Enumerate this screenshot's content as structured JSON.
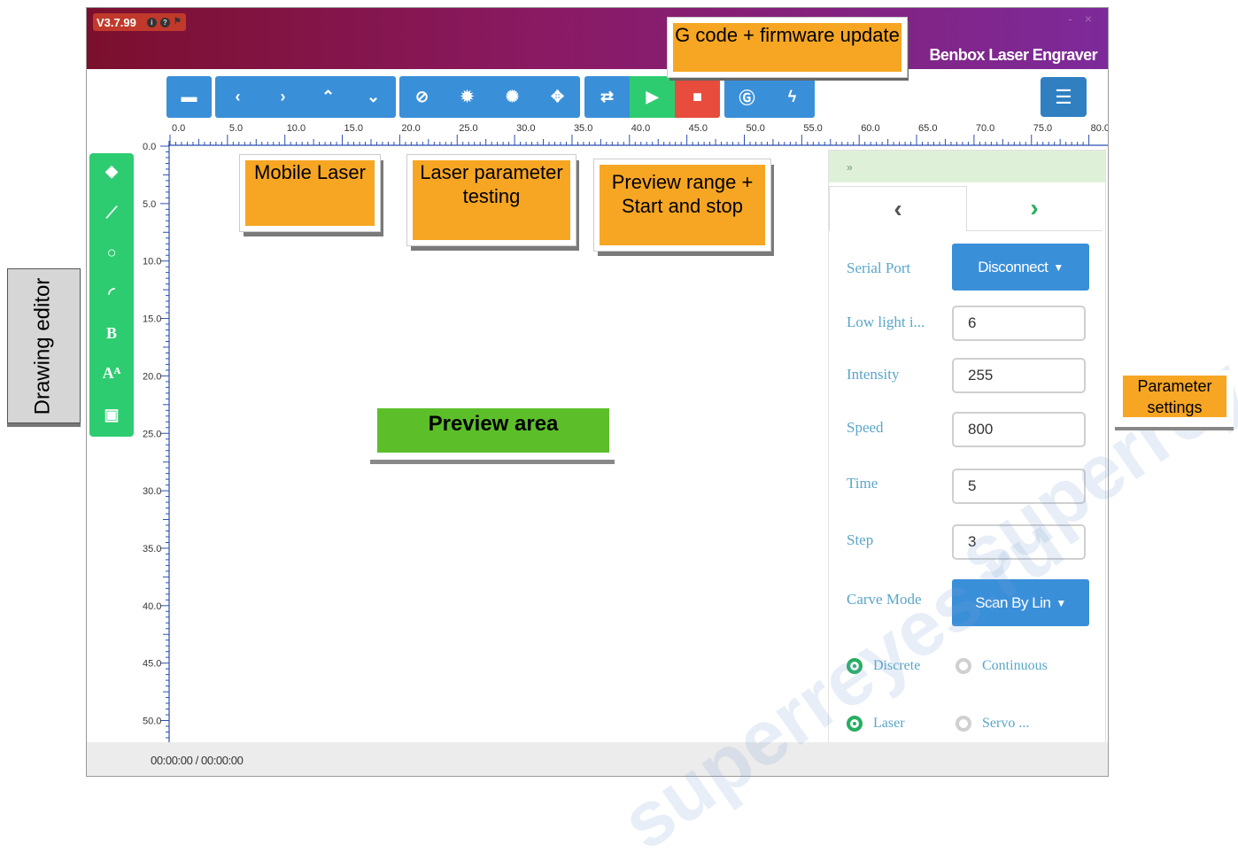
{
  "window": {
    "version": "V3.7.99",
    "title": "Benbox Laser Engraver",
    "minimize": "-",
    "close": "×"
  },
  "toolbar": {
    "groups": [
      {
        "name": "file",
        "buttons": [
          {
            "icon": "folder-open-icon",
            "glyph": "▬"
          }
        ]
      },
      {
        "name": "move",
        "buttons": [
          {
            "icon": "chevron-left-icon",
            "glyph": "‹"
          },
          {
            "icon": "chevron-right-icon",
            "glyph": "›"
          },
          {
            "icon": "chevron-up-icon",
            "glyph": "⌃"
          },
          {
            "icon": "chevron-down-icon",
            "glyph": "⌄"
          }
        ]
      },
      {
        "name": "laser-test",
        "buttons": [
          {
            "icon": "ban-icon",
            "glyph": "⊘"
          },
          {
            "icon": "sun-dim-icon",
            "glyph": "✹"
          },
          {
            "icon": "sun-bright-icon",
            "glyph": "✺"
          },
          {
            "icon": "crosshair-icon",
            "glyph": "✥"
          }
        ]
      },
      {
        "name": "run",
        "buttons": [
          {
            "icon": "preview-range-icon",
            "glyph": "⇄"
          },
          {
            "icon": "play-icon",
            "glyph": "▶"
          },
          {
            "icon": "stop-icon",
            "glyph": "■"
          }
        ]
      },
      {
        "name": "gcode",
        "buttons": [
          {
            "icon": "gcode-icon",
            "glyph": "Ⓖ"
          },
          {
            "icon": "lightning-icon",
            "glyph": "ϟ"
          }
        ]
      }
    ],
    "menu_glyph": "☰"
  },
  "ruler": {
    "h_labels": [
      "0.0",
      "5.0",
      "10.0",
      "15.0",
      "20.0",
      "25.0",
      "30.0",
      "35.0",
      "40.0",
      "45.0",
      "50.0",
      "55.0",
      "60.0",
      "65.0",
      "70.0",
      "75.0",
      "80.0"
    ],
    "v_labels": [
      "0.0",
      "5.0",
      "10.0",
      "15.0",
      "20.0",
      "25.0",
      "30.0",
      "35.0",
      "40.0",
      "45.0",
      "50.0"
    ]
  },
  "left_tools": [
    {
      "icon": "tag-icon",
      "glyph": "◆"
    },
    {
      "icon": "line-icon",
      "glyph": "⟋"
    },
    {
      "icon": "circle-icon",
      "glyph": "○"
    },
    {
      "icon": "arc-icon",
      "glyph": "◜"
    },
    {
      "icon": "bold-text-icon",
      "glyph": "B"
    },
    {
      "icon": "font-size-icon",
      "glyph": "Aᴬ"
    },
    {
      "icon": "image-icon",
      "glyph": "▣"
    }
  ],
  "panel": {
    "collapse": "»",
    "tab_prev": "‹",
    "tab_next": "›",
    "serial_port_label": "Serial Port",
    "serial_port_button": "Disconnect",
    "low_light_label": "Low light i...",
    "low_light_value": "6",
    "intensity_label": "Intensity",
    "intensity_value": "255",
    "speed_label": "Speed",
    "speed_value": "800",
    "time_label": "Time",
    "time_value": "5",
    "step_label": "Step",
    "step_value": "3",
    "carve_mode_label": "Carve Mode",
    "carve_mode_button": "Scan By Lin",
    "radio_discrete": "Discrete",
    "radio_continuous": "Continuous",
    "radio_laser": "Laser",
    "radio_servo": "Servo ..."
  },
  "status": {
    "timer": "00:00:00 / 00:00:00"
  },
  "callouts": {
    "gcode": "G code + firmware update",
    "mobile_laser": "Mobile Laser",
    "laser_param": "Laser parameter testing",
    "preview_range": "Preview range + Start and stop",
    "preview_area": "Preview area",
    "drawing_editor": "Drawing editor",
    "parameter_settings": "Parameter settings"
  },
  "watermark": "superreyes.ru"
}
